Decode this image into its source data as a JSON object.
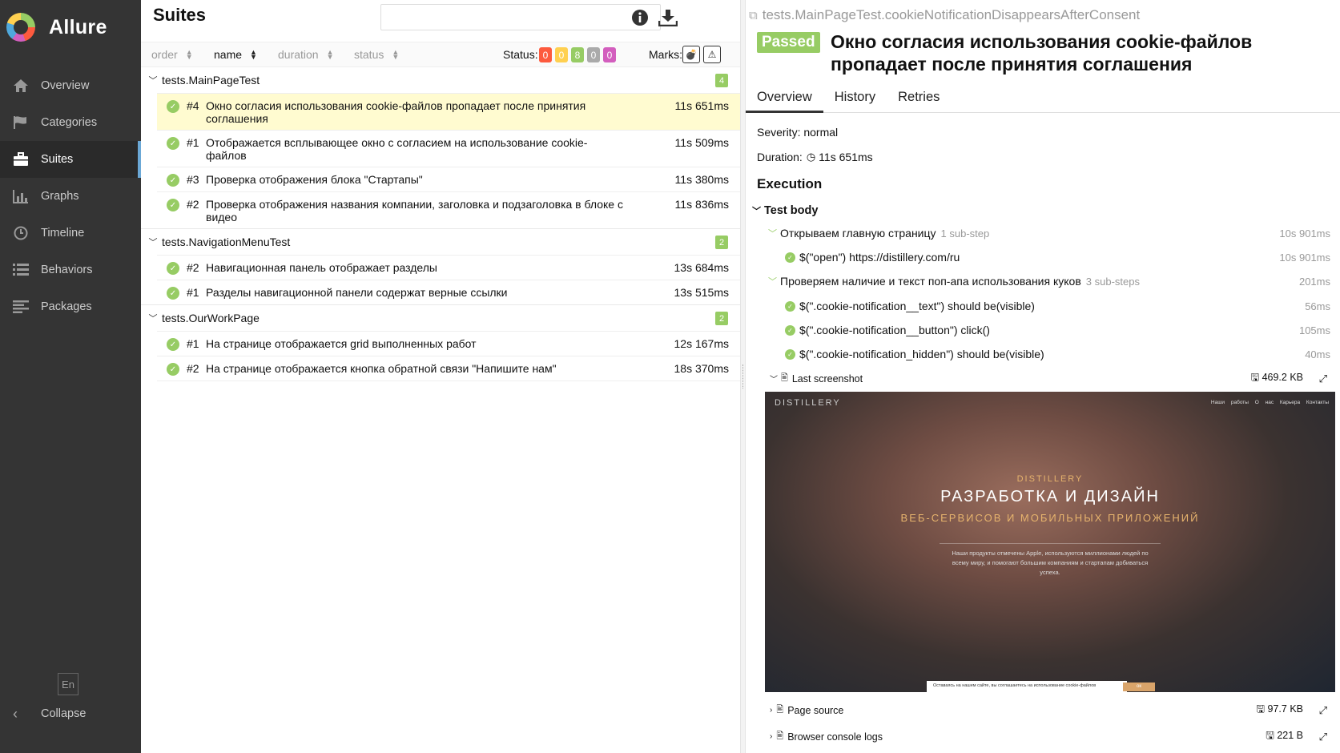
{
  "app": {
    "name": "Allure"
  },
  "nav": [
    {
      "label": "Overview",
      "icon": "home-icon"
    },
    {
      "label": "Categories",
      "icon": "flag-icon"
    },
    {
      "label": "Suites",
      "icon": "briefcase-icon"
    },
    {
      "label": "Graphs",
      "icon": "bar-chart-icon"
    },
    {
      "label": "Timeline",
      "icon": "clock-icon"
    },
    {
      "label": "Behaviors",
      "icon": "list-icon"
    },
    {
      "label": "Packages",
      "icon": "align-left-icon"
    }
  ],
  "language": "En",
  "collapse_label": "Collapse",
  "suites": {
    "title": "Suites",
    "search": {
      "value": "",
      "placeholder": ""
    },
    "sort": {
      "order": "order",
      "name": "name",
      "duration": "duration",
      "status": "status"
    },
    "status_label": "Status:",
    "status_counts": [
      {
        "value": "0",
        "color": "#fd5a3e"
      },
      {
        "value": "0",
        "color": "#ffd050"
      },
      {
        "value": "8",
        "color": "#97cc64"
      },
      {
        "value": "0",
        "color": "#aaaaaa"
      },
      {
        "value": "0",
        "color": "#d35ebe"
      }
    ],
    "marks_label": "Marks:",
    "groups": [
      {
        "name": "tests.MainPageTest",
        "count": "4",
        "rows": [
          {
            "num": "#4",
            "name": "Окно согласия использования cookie-файлов пропадает после принятия соглашения",
            "duration": "11s 651ms"
          },
          {
            "num": "#1",
            "name": "Отображается всплывающее окно с согласием на использование cookie-файлов",
            "duration": "11s 509ms"
          },
          {
            "num": "#3",
            "name": "Проверка отображения блока \"Стартапы\"",
            "duration": "11s 380ms"
          },
          {
            "num": "#2",
            "name": "Проверка отображения названия компании, заголовка и подзаголовка в блоке с видео",
            "duration": "11s 836ms"
          }
        ]
      },
      {
        "name": "tests.NavigationMenuTest",
        "count": "2",
        "rows": [
          {
            "num": "#2",
            "name": "Навигационная панель отображает разделы",
            "duration": "13s 684ms"
          },
          {
            "num": "#1",
            "name": "Разделы навигационной панели содержат верные ссылки",
            "duration": "13s 515ms"
          }
        ]
      },
      {
        "name": "tests.OurWorkPage",
        "count": "2",
        "rows": [
          {
            "num": "#1",
            "name": "На странице отображается grid выполненных работ",
            "duration": "12s 167ms"
          },
          {
            "num": "#2",
            "name": "На странице отображается кнопка обратной связи \"Напишите нам\"",
            "duration": "18s 370ms"
          }
        ]
      }
    ]
  },
  "testcase": {
    "fullname": "tests.MainPageTest.cookieNotificationDisappearsAfterConsent",
    "status": "Passed",
    "title": "Окно согласия использования cookie-файлов пропадает после принятия соглашения",
    "tabs": [
      "Overview",
      "History",
      "Retries"
    ],
    "severity": "Severity: normal",
    "duration_label": "Duration:",
    "duration": "11s 651ms",
    "execution_label": "Execution",
    "test_body_label": "Test body",
    "steps": [
      {
        "name": "Открываем главную страницу",
        "sub": "1 sub-step",
        "time": "10s 901ms"
      },
      {
        "name": "$(\"open\") https://distillery.com/ru",
        "time": "10s 901ms"
      },
      {
        "name": "Проверяем наличие и текст поп-апа использования куков",
        "sub": "3 sub-steps",
        "time": "201ms"
      },
      {
        "name": "$(\".cookie-notification__text\") should be(visible)",
        "time": "56ms"
      },
      {
        "name": "$(\".cookie-notification__button\") click()",
        "time": "105ms"
      },
      {
        "name": "$(\".cookie-notification_hidden\") should be(visible)",
        "time": "40ms"
      }
    ],
    "attachments": [
      {
        "name": "Last screenshot",
        "size": "469.2 KB"
      },
      {
        "name": "Page source",
        "size": "97.7 KB"
      },
      {
        "name": "Browser console logs",
        "size": "221 B"
      }
    ],
    "screenshot": {
      "logo": "DISTILLERY",
      "nav": "Наши работы О нас Карьера Контакты",
      "kicker": "DISTILLERY",
      "heading": "РАЗРАБОТКА И ДИЗАЙН",
      "subheading": "ВЕБ-СЕРВИСОВ И МОБИЛЬНЫХ ПРИЛОЖЕНИЙ",
      "paragraph": "Наши продукты отмечены Apple, используются миллионами людей по всему миру, и помогают большим компаниям и стартапам добиваться успеха.",
      "cookie_text": "Оставаясь на нашем сайте, вы соглашаетесь на использование cookie-файлов",
      "cookie_button": "ок"
    }
  }
}
